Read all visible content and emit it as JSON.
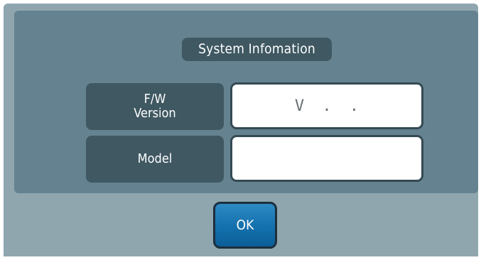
{
  "dialog": {
    "title": "System Infomation",
    "rows": [
      {
        "label_line1": "F/W",
        "label_line2": "Version",
        "value": "V . ."
      },
      {
        "label": "Model",
        "value": ""
      }
    ],
    "ok_label": "OK"
  },
  "colors": {
    "dialog_bg": "#8fa6ae",
    "panel_bg": "#658290",
    "label_bg": "#3f5862",
    "value_bg": "#ffffff",
    "button_blue": "#1470ad"
  }
}
